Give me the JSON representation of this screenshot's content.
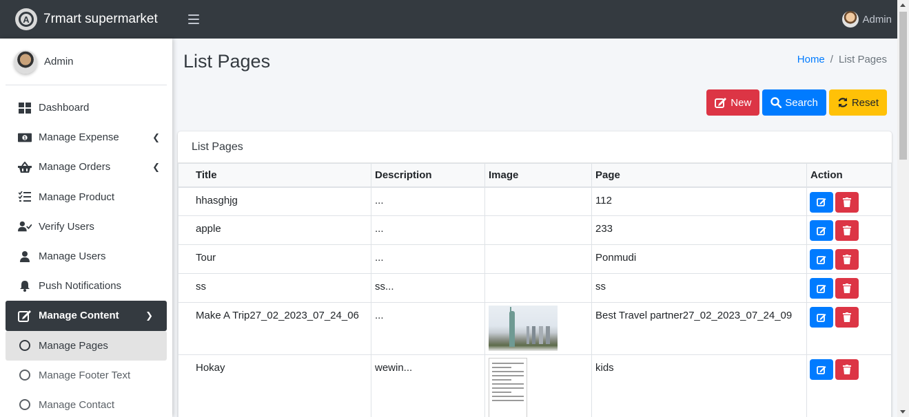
{
  "brand": {
    "name": "7rmart supermarket"
  },
  "topbar": {
    "user_name": "Admin"
  },
  "sidebar": {
    "user_name": "Admin",
    "items": [
      {
        "label": "Dashboard",
        "icon": "dashboard-icon"
      },
      {
        "label": "Manage Expense",
        "icon": "money-icon"
      },
      {
        "label": "Manage Orders",
        "icon": "basket-icon"
      },
      {
        "label": "Manage Product",
        "icon": "tasks-icon"
      },
      {
        "label": "Verify Users",
        "icon": "user-check-icon"
      },
      {
        "label": "Manage Users",
        "icon": "user-icon"
      },
      {
        "label": "Push Notifications",
        "icon": "bell-icon"
      },
      {
        "label": "Manage Content",
        "icon": "edit-icon"
      },
      {
        "label": "Manage Pages",
        "icon": "circle-icon"
      },
      {
        "label": "Manage Footer Text",
        "icon": "circle-icon"
      },
      {
        "label": "Manage Contact",
        "icon": "circle-icon"
      }
    ]
  },
  "page": {
    "title": "List Pages",
    "breadcrumb": {
      "home": "Home",
      "separator": "/",
      "current": "List Pages"
    }
  },
  "toolbar": {
    "new_label": "New",
    "search_label": "Search",
    "reset_label": "Reset"
  },
  "card": {
    "title": "List Pages"
  },
  "table": {
    "headers": [
      "Title",
      "Description",
      "Image",
      "Page",
      "Action"
    ],
    "rows": [
      {
        "title": "hhasghjg",
        "description": "...",
        "image": "",
        "page": "112"
      },
      {
        "title": "apple",
        "description": "...",
        "image": "",
        "page": "233"
      },
      {
        "title": "Tour",
        "description": "...",
        "image": "",
        "page": "Ponmudi"
      },
      {
        "title": "ss",
        "description": "ss...",
        "image": "",
        "page": "ss"
      },
      {
        "title": "Make A Trip27_02_2023_07_24_06",
        "description": "...",
        "image": "travel-thumbnail",
        "page": "Best Travel partner27_02_2023_07_24_09"
      },
      {
        "title": "Hokay",
        "description": "wewin...",
        "image": "document-thumbnail",
        "page": "kids"
      }
    ]
  },
  "colors": {
    "topbar": "#343a40",
    "primary": "#007bff",
    "danger": "#dc3545",
    "warning": "#ffc107",
    "background": "#f4f6f9"
  }
}
